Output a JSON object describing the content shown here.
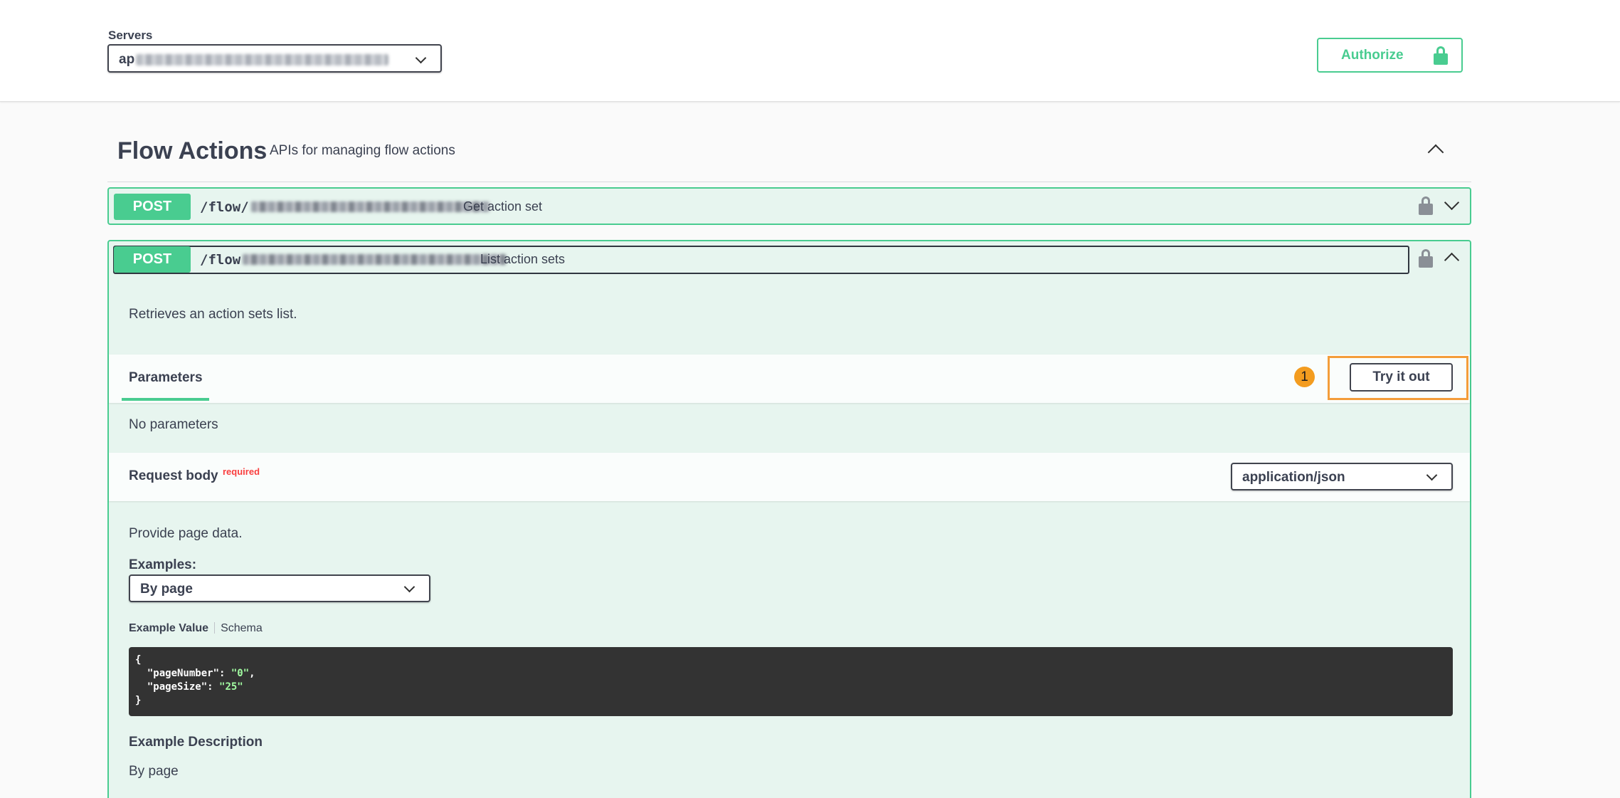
{
  "servers": {
    "label": "Servers",
    "selected_prefix": "ap"
  },
  "authorize": {
    "label": "Authorize"
  },
  "tag": {
    "title": "Flow Actions",
    "description": "APIs for managing flow actions"
  },
  "operations": [
    {
      "method": "POST",
      "path_prefix": "/flow/",
      "summary": "Get action set"
    },
    {
      "method": "POST",
      "path_prefix": "/flow",
      "summary": "List action sets",
      "description": "Retrieves an action sets list.",
      "parameters": {
        "tab_label": "Parameters",
        "badge": "1",
        "try_it_out_label": "Try it out",
        "empty_text": "No parameters"
      },
      "request_body": {
        "title": "Request body",
        "required_label": "required",
        "content_type": "application/json",
        "description": "Provide page data.",
        "examples_label": "Examples:",
        "example_selected": "By page",
        "tab_example_value": "Example Value",
        "tab_schema": "Schema",
        "code": {
          "open": "{",
          "key1": "\"pageNumber\"",
          "val1": "\"0\"",
          "key2": "\"pageSize\"",
          "val2": "\"25\"",
          "close": "}"
        },
        "example_description_title": "Example Description",
        "example_description_text": "By page"
      }
    }
  ]
}
